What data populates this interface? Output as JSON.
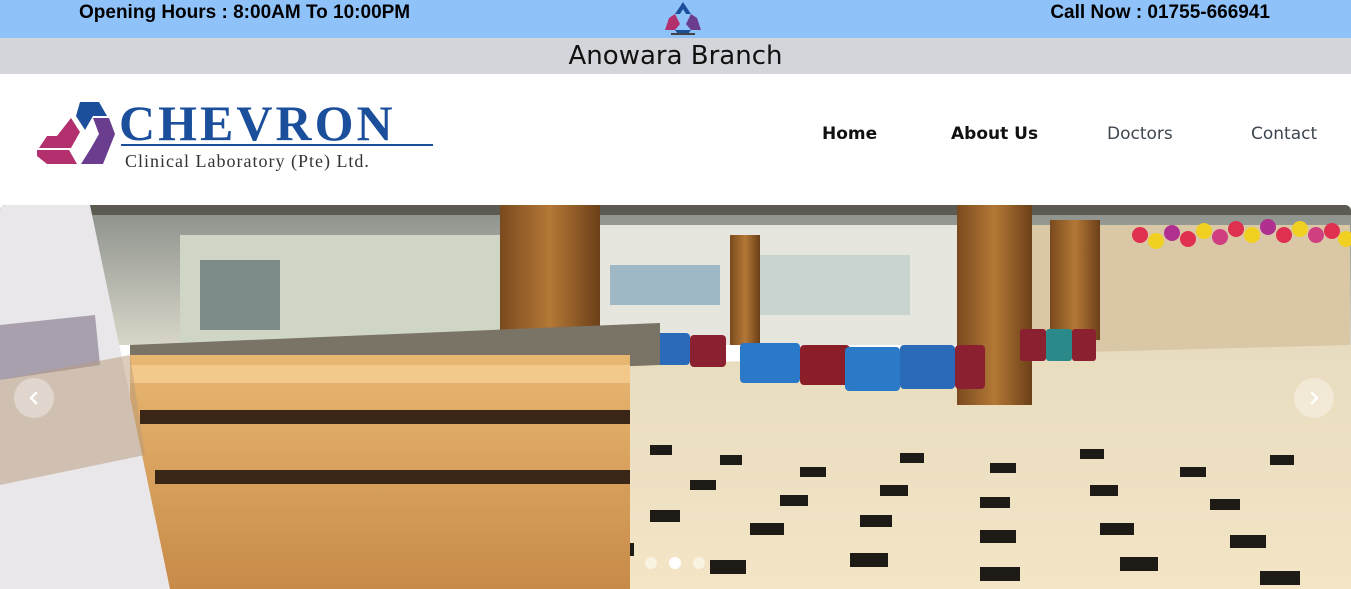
{
  "topbar": {
    "opening_hours": "Opening Hours : 8:00AM To 10:00PM",
    "call_now": "Call Now : 01755-666941",
    "background": "#90c2fa"
  },
  "branch": {
    "name": "Anowara Branch"
  },
  "logo": {
    "brand": "CHEVRON",
    "subtitle": "Clinical Laboratory (Pte) Ltd.",
    "brand_color": "#1b4f9c",
    "accent_color": "#b3306f"
  },
  "nav": {
    "items": [
      {
        "label": "Home"
      },
      {
        "label": "About Us"
      },
      {
        "label": "Doctors"
      },
      {
        "label": "Contact"
      }
    ]
  },
  "carousel": {
    "slide_image": "clinic-reception-lobby",
    "active_index": 1,
    "indicator_count": 3,
    "prev_icon": "chevron-left-icon",
    "next_icon": "chevron-right-icon"
  }
}
